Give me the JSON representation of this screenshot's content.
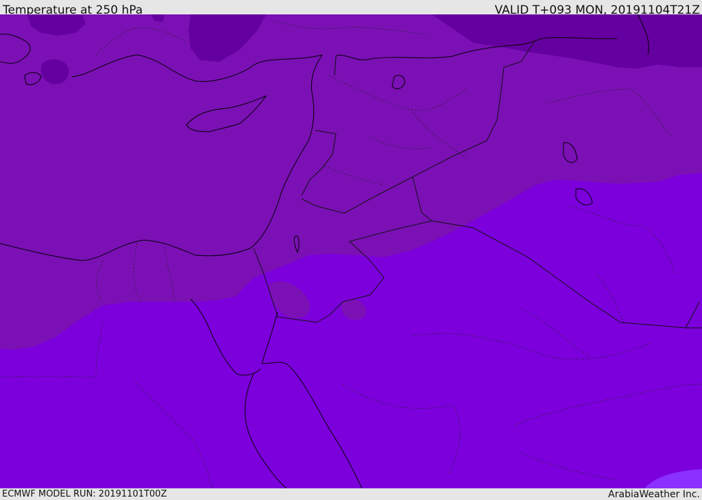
{
  "header": {
    "title": "Temperature at 250 hPa",
    "valid_time": "VALID T+093 MON, 20191104T21Z"
  },
  "footer": {
    "model_run": "ECMWF MODEL RUN: 20191101T00Z",
    "credit": "ArabiaWeather Inc."
  },
  "map": {
    "field": "temperature",
    "level_hpa": 250,
    "colors": {
      "band_cold": "#6500a0",
      "band_mid": "#7b10b5",
      "band_warm": "#7c00dc",
      "band_warmest": "#8a30ff",
      "coastline": "#000000",
      "border": "#222222"
    }
  }
}
